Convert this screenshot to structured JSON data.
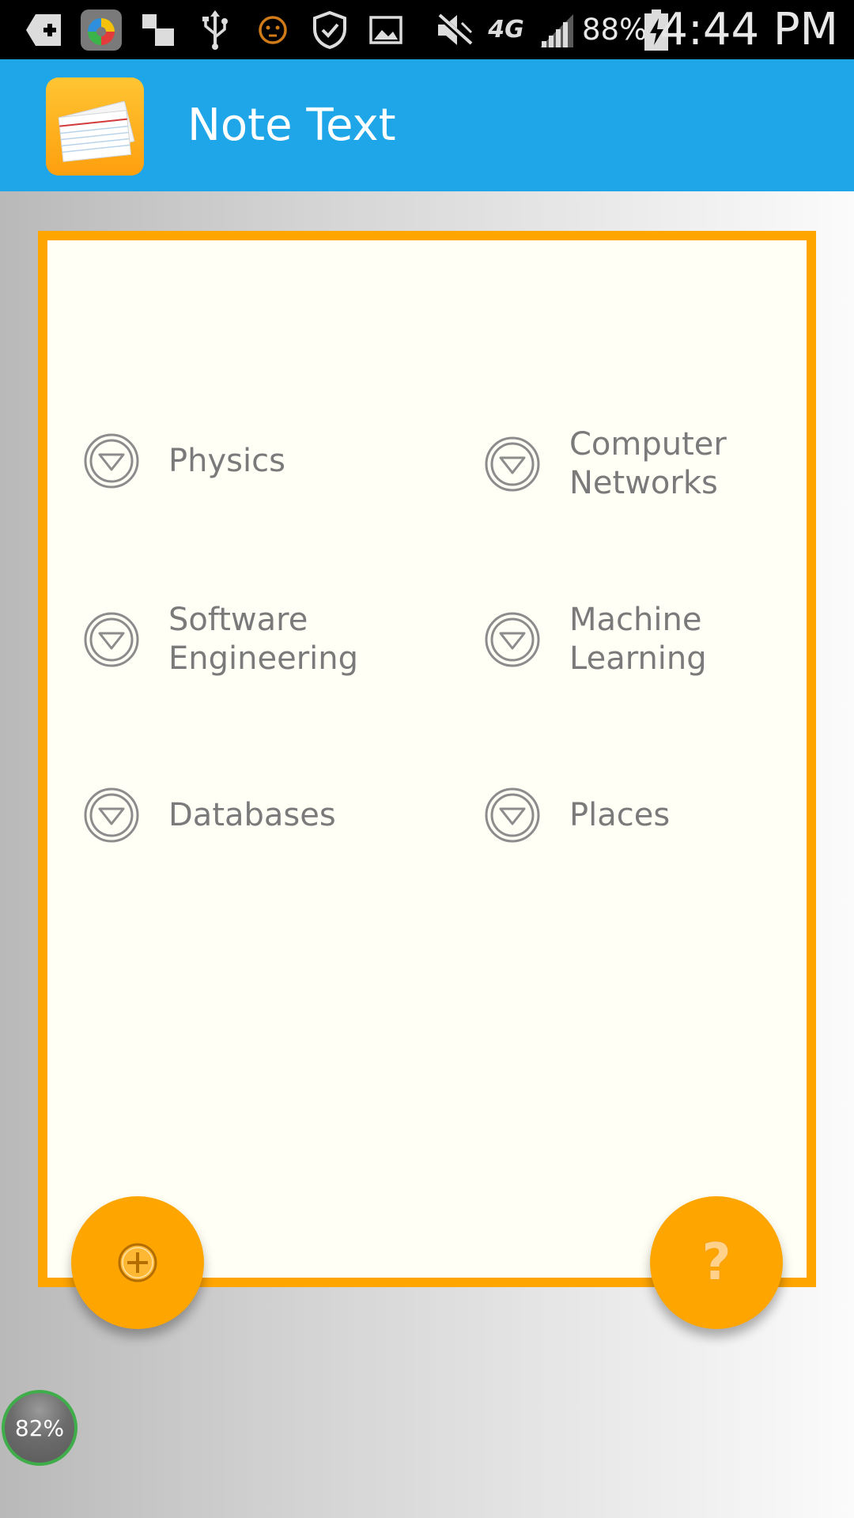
{
  "status_bar": {
    "battery_percent": "88%",
    "time": "4:44 PM",
    "network": "4G",
    "icons": [
      "add-box-icon",
      "app-store-icon",
      "blocks-icon",
      "usb-icon",
      "face-icon",
      "shield-check-icon",
      "image-icon",
      "mute-icon",
      "network-4g-icon",
      "signal-icon",
      "battery-charging-icon"
    ]
  },
  "app_bar": {
    "title": "Note Text",
    "logo": "index-cards-icon",
    "color": "#1ea6e8"
  },
  "topics": [
    {
      "label": "Physics",
      "icon": "dropdown-circle-icon"
    },
    {
      "label": "Computer\nNetworks",
      "icon": "dropdown-circle-icon"
    },
    {
      "label": "Software\nEngineering",
      "icon": "dropdown-circle-icon"
    },
    {
      "label": "Machine\nLearning",
      "icon": "dropdown-circle-icon"
    },
    {
      "label": "Databases",
      "icon": "dropdown-circle-icon"
    },
    {
      "label": "Places",
      "icon": "dropdown-circle-icon"
    }
  ],
  "fabs": {
    "add": {
      "icon": "add-circle-icon"
    },
    "help": {
      "glyph": "?",
      "icon": "help-icon"
    }
  },
  "overlay_bubble": {
    "text": "82%"
  },
  "colors": {
    "accent": "#ffa500",
    "panel_background": "#fffff5",
    "app_bar": "#1ea6e8",
    "topic_text": "#7a7a7a"
  }
}
